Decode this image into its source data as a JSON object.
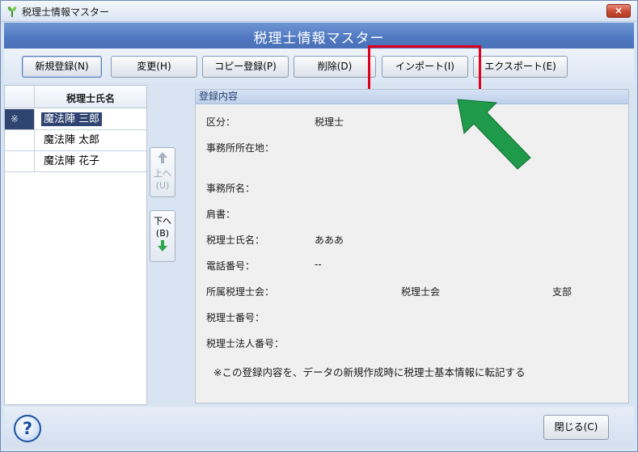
{
  "window": {
    "title": "税理士情報マスター",
    "close_glyph": "×"
  },
  "header": {
    "title": "税理士情報マスター"
  },
  "toolbar": {
    "buttons": [
      {
        "label": "新規登録(N)"
      },
      {
        "label": "変更(H)"
      },
      {
        "label": "コピー登録(P)"
      },
      {
        "label": "削除(D)"
      },
      {
        "label": "インポート(I)"
      },
      {
        "label": "エクスポート(E)"
      }
    ]
  },
  "list": {
    "header": "税理士氏名",
    "rows": [
      {
        "mark": "※",
        "name": "魔法陣 三郎",
        "selected": true
      },
      {
        "mark": "",
        "name": "魔法陣 太郎",
        "selected": false
      },
      {
        "mark": "",
        "name": "魔法陣 花子",
        "selected": false
      }
    ]
  },
  "move": {
    "up": {
      "line1": "上へ",
      "line2": "(U)"
    },
    "down": {
      "line1": "下へ",
      "line2": "(B)"
    }
  },
  "details": {
    "header": "登録内容",
    "fields": {
      "kubun": {
        "label": "区分：",
        "value": "税理士"
      },
      "address": {
        "label": "事務所所在地："
      },
      "office": {
        "label": "事務所名："
      },
      "title": {
        "label": "肩書："
      },
      "name": {
        "label": "税理士氏名：",
        "value": "あああ"
      },
      "phone": {
        "label": "電話番号：",
        "value": "--"
      },
      "association": {
        "label": "所属税理士会：",
        "value1": "税理士会",
        "value2": "支部"
      },
      "number": {
        "label": "税理士番号："
      },
      "corp_number": {
        "label": "税理士法人番号："
      }
    },
    "note": "※この登録内容を、データの新規作成時に税理士基本情報に転記する"
  },
  "footer": {
    "help": "?",
    "close": "閉じる(C)"
  },
  "colors": {
    "highlight_box": "#e0001b",
    "arrow": "#1f9a4a",
    "header_band": "#4f78c0"
  }
}
